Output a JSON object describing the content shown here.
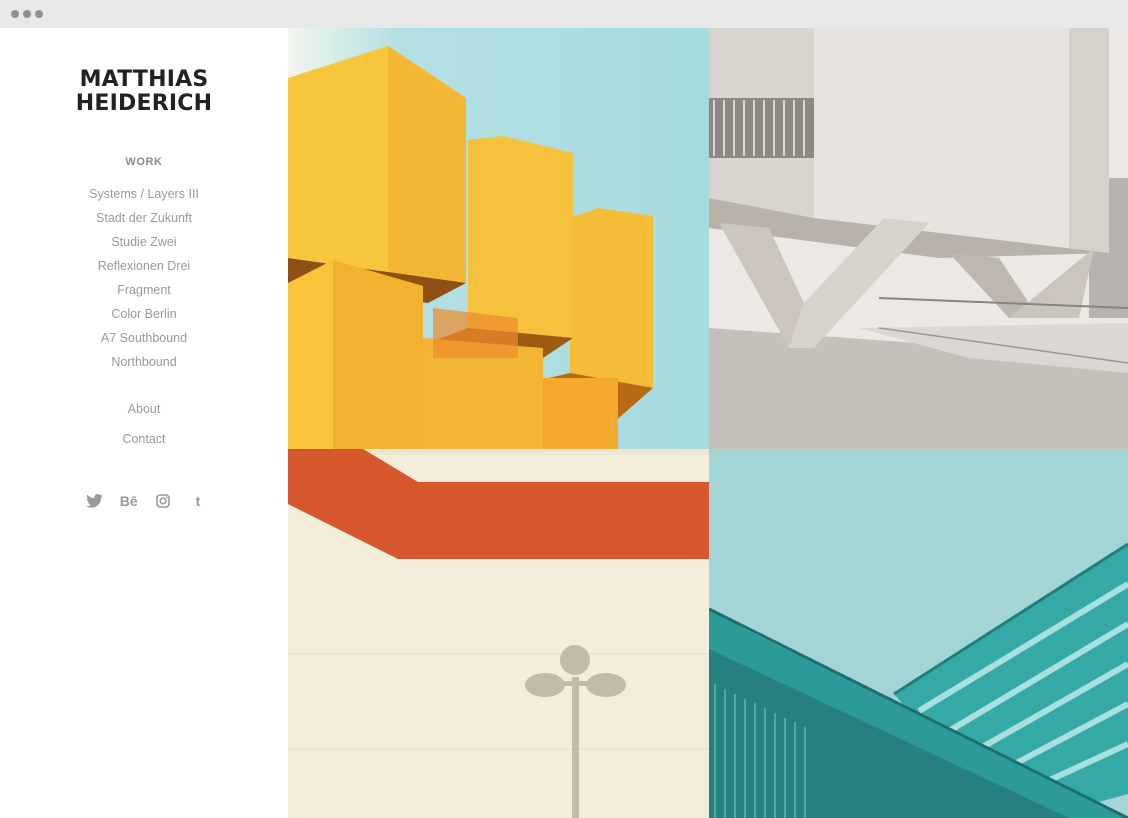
{
  "window": {
    "controls": [
      "close",
      "minimize",
      "maximize"
    ]
  },
  "sidebar": {
    "logo": {
      "line1": "MATTHIAS",
      "line2": "HEIDERICH"
    },
    "work_heading": "WORK",
    "work_items": [
      "Systems / Layers III",
      "Stadt der Zukunft",
      "Studie Zwei",
      "Reflexionen Drei",
      "Fragment",
      "Color Berlin",
      "A7 Southbound",
      "Northbound"
    ],
    "about": "About",
    "contact": "Contact",
    "social": [
      {
        "icon": "twitter-icon"
      },
      {
        "icon": "behance-icon",
        "glyph": "Bē"
      },
      {
        "icon": "instagram-icon"
      },
      {
        "icon": "tumblr-icon",
        "glyph": "t"
      }
    ]
  },
  "gallery": {
    "tiles": [
      {
        "subject": "yellow-cubes",
        "colors": {
          "sky": "#a9dde0",
          "cube": "#f6c13a",
          "shade": "#eea92e"
        }
      },
      {
        "subject": "concrete-building",
        "colors": {
          "sky": "#f0ede9",
          "concrete": "#d9d5d0",
          "ground": "#b9b3ac"
        }
      },
      {
        "subject": "orange-stripe-wall",
        "colors": {
          "wall": "#f3eedc",
          "stripe": "#d85a2d"
        }
      },
      {
        "subject": "teal-facade",
        "colors": {
          "sky": "#a3d5d5",
          "facade": "#2e9e9c"
        }
      }
    ]
  }
}
